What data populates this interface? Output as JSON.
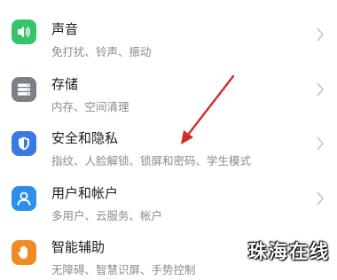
{
  "settings_items": [
    {
      "title": "声音",
      "subtitle": "免打扰、铃声、振动",
      "icon": "speaker-icon"
    },
    {
      "title": "存储",
      "subtitle": "内存、空间清理",
      "icon": "storage-icon"
    },
    {
      "title": "安全和隐私",
      "subtitle": "指纹、人脸解锁、锁屏和密码、学生模式",
      "icon": "shield-icon"
    },
    {
      "title": "用户和帐户",
      "subtitle": "多用户、云服务、帐户",
      "icon": "user-icon"
    },
    {
      "title": "智能辅助",
      "subtitle": "无障碍、智慧识屏、手势控制",
      "icon": "hand-icon"
    }
  ],
  "colors": {
    "annotation_arrow": "#d42a2a",
    "sound": "#36c36a",
    "storage": "#7b8087",
    "security": "#3979e6",
    "users": "#2e8fe8",
    "assist": "#f08a24"
  },
  "watermark": "珠海在线"
}
